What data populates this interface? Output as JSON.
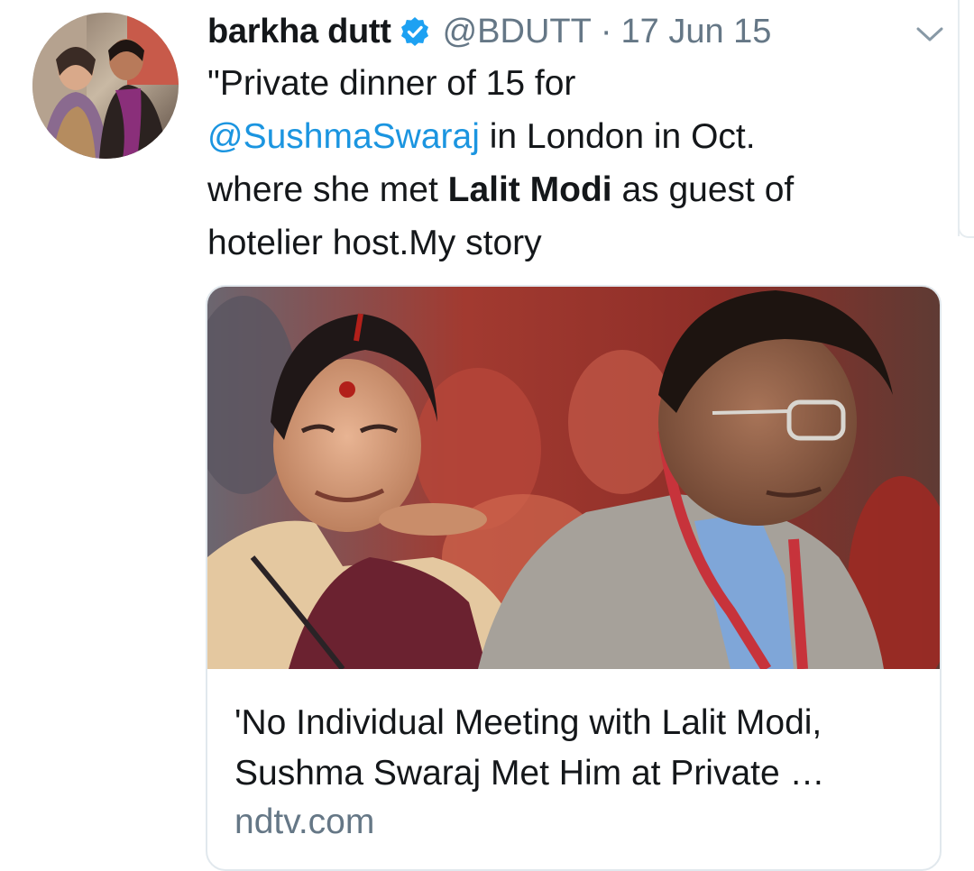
{
  "tweet": {
    "author": {
      "display_name": "barkha dutt",
      "handle": "@BDUTT",
      "verified": true,
      "avatar_icon": "avatar-photo"
    },
    "separator": "·",
    "date": "17 Jun 15",
    "menu_icon": "chevron-down-icon",
    "text": {
      "line1": "\"Private dinner of 15 for",
      "mention": "@SushmaSwaraj",
      "line2_rest": " in London in Oct.",
      "line3_pre": "where she met ",
      "line3_bold": "Lalit Modi",
      "line3_post": " as guest of",
      "line4": "hotelier host.My story"
    },
    "card": {
      "image_icon": "news-photo",
      "title_line1": "'No Individual Meeting with Lalit Modi,",
      "title_line2": "Sushma Swaraj Met Him at Private …",
      "domain": "ndtv.com"
    }
  },
  "colors": {
    "text": "#14171a",
    "secondary": "#657786",
    "link": "#1b95e0",
    "verified": "#1da1f2",
    "border": "#e1e8ed"
  }
}
